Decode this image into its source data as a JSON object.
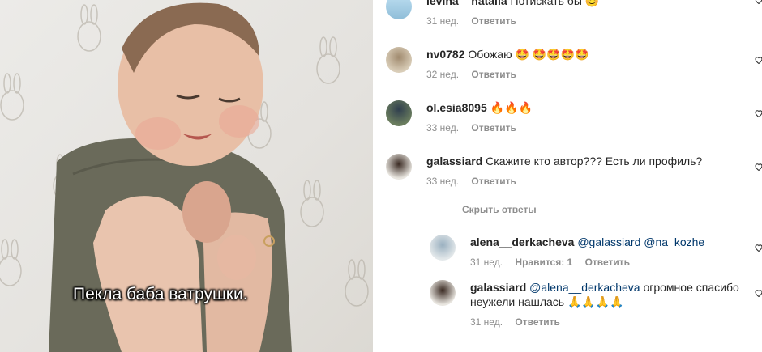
{
  "video": {
    "subtitle": "Пекла баба ватрушки."
  },
  "comments": [
    {
      "username": "levina__natalia",
      "text": "Потискать бы 😊",
      "time": "31 нед.",
      "reply": "Ответить"
    },
    {
      "username": "nv0782",
      "text": "Обожаю 🤩 🤩🤩🤩🤩",
      "time": "32 нед.",
      "reply": "Ответить"
    },
    {
      "username": "ol.esia8095",
      "text": "🔥🔥🔥",
      "time": "33 нед.",
      "reply": "Ответить"
    },
    {
      "username": "galassiard",
      "text": "Скажите кто автор??? Есть ли профиль?",
      "time": "33 нед.",
      "reply": "Ответить"
    }
  ],
  "hide_replies": "Скрыть ответы",
  "replies": [
    {
      "username": "alena__derkacheva",
      "mention": "@galassiard @na_kozhe",
      "text": "",
      "time": "31 нед.",
      "likes": "Нравится: 1",
      "reply": "Ответить"
    },
    {
      "username": "galassiard",
      "mention": "@alena__derkacheva",
      "text": "огромное спасибо",
      "text2": "неужели нашлась 🙏🙏🙏🙏",
      "time": "31 нед.",
      "reply": "Ответить"
    }
  ],
  "colors": {
    "muted": "#8e8e8e",
    "mention": "#00376b",
    "text": "#262626"
  }
}
